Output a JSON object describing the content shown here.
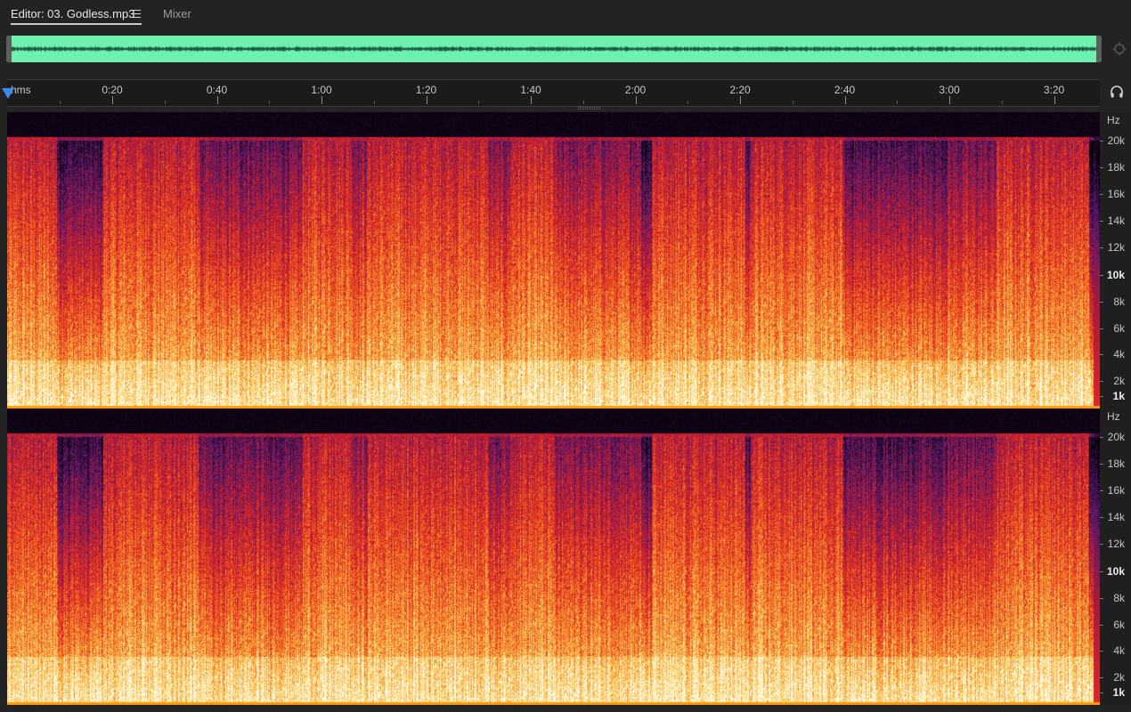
{
  "tabs": {
    "editor_label": "Editor: 03. Godless.mp3",
    "mixer_label": "Mixer"
  },
  "icons": {
    "tab_menu": "hamburger-menu-icon",
    "zoom": "zoom-magnifier-icon",
    "monitor": "headphones-icon"
  },
  "overview": {
    "fill_color": "#6ef0b0",
    "wave_color": "#1d5a3f"
  },
  "ruler": {
    "unit_label": "hms",
    "ticks": [
      "0:20",
      "0:40",
      "1:00",
      "1:20",
      "1:40",
      "2:00",
      "2:20",
      "2:40",
      "3:00",
      "3:20"
    ]
  },
  "playhead": {
    "position_label": "0:00",
    "color": "#3b8ae6"
  },
  "channels": [
    {
      "id": "left"
    },
    {
      "id": "right"
    }
  ],
  "frequency_axis": {
    "unit_label": "Hz",
    "labels": [
      "20k",
      "18k",
      "16k",
      "14k",
      "12k",
      "10k",
      "8k",
      "6k",
      "4k",
      "2k",
      "1k"
    ],
    "bold_labels": [
      "10k",
      "1k"
    ]
  },
  "spectrogram_palette": [
    "#000000",
    "#2a0a3c",
    "#5a1a6e",
    "#a31a3c",
    "#d8222a",
    "#f25a1a",
    "#f7a43a",
    "#fde07a",
    "#ffffff"
  ]
}
